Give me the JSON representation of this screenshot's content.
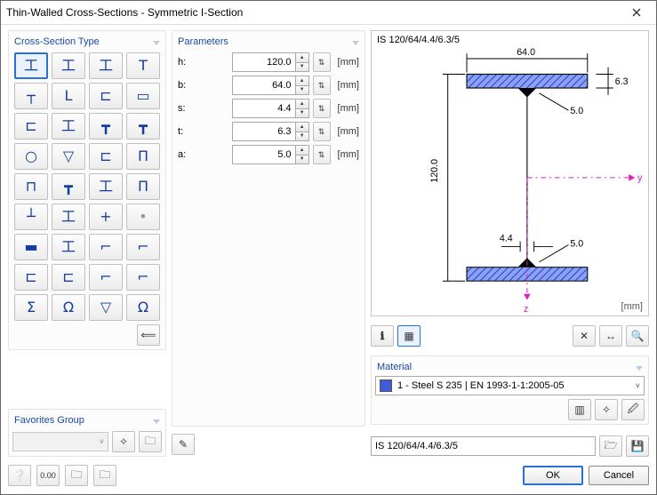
{
  "window": {
    "title": "Thin-Walled Cross-Sections - Symmetric I-Section"
  },
  "crossSection": {
    "title": "Cross-Section Type",
    "items": [
      {
        "name": "i-section",
        "g": "工"
      },
      {
        "name": "i-asym",
        "g": "工"
      },
      {
        "name": "i-left",
        "g": "工"
      },
      {
        "name": "t-section",
        "g": "T"
      },
      {
        "name": "t-down",
        "g": "┬"
      },
      {
        "name": "angle-l",
        "g": "L"
      },
      {
        "name": "channel-c",
        "g": "⊏"
      },
      {
        "name": "rect-tube",
        "g": "▭"
      },
      {
        "name": "channel-open",
        "g": "⊏"
      },
      {
        "name": "i2",
        "g": "工"
      },
      {
        "name": "t-y",
        "g": "┳"
      },
      {
        "name": "y-section",
        "g": "┳"
      },
      {
        "name": "circle",
        "g": "○"
      },
      {
        "name": "triangle",
        "g": "▽"
      },
      {
        "name": "channel2",
        "g": "⊏"
      },
      {
        "name": "pi",
        "g": "Π"
      },
      {
        "name": "double-channel",
        "g": "⊓"
      },
      {
        "name": "i-top",
        "g": "┳"
      },
      {
        "name": "i3",
        "g": "工"
      },
      {
        "name": "pi2",
        "g": "Π"
      },
      {
        "name": "tee-down",
        "g": "┴"
      },
      {
        "name": "i4",
        "g": "工"
      },
      {
        "name": "plus",
        "g": "+"
      },
      {
        "name": "dot",
        "g": "•"
      },
      {
        "name": "flat-bar",
        "g": "▬"
      },
      {
        "name": "i5",
        "g": "工"
      },
      {
        "name": "zee",
        "g": "⌐"
      },
      {
        "name": "zee2",
        "g": "⌐"
      },
      {
        "name": "channel3",
        "g": "⊏"
      },
      {
        "name": "channel4",
        "g": "⊏"
      },
      {
        "name": "angle2",
        "g": "⌐"
      },
      {
        "name": "angle3",
        "g": "⌐"
      },
      {
        "name": "sigma",
        "g": "Σ"
      },
      {
        "name": "omega",
        "g": "Ω"
      },
      {
        "name": "trap",
        "g": "▽"
      },
      {
        "name": "omega2",
        "g": "Ω"
      }
    ]
  },
  "favorites": {
    "title": "Favorites Group"
  },
  "parameters": {
    "title": "Parameters",
    "rows": [
      {
        "k": "h",
        "label": "h:",
        "value": "120.0",
        "unit": "[mm]"
      },
      {
        "k": "b",
        "label": "b:",
        "value": "64.0",
        "unit": "[mm]"
      },
      {
        "k": "s",
        "label": "s:",
        "value": "4.4",
        "unit": "[mm]"
      },
      {
        "k": "t",
        "label": "t:",
        "value": "6.3",
        "unit": "[mm]"
      },
      {
        "k": "a",
        "label": "a:",
        "value": "5.0",
        "unit": "[mm]"
      }
    ]
  },
  "preview": {
    "designation": "IS 120/64/4.4/6.3/5",
    "unit": "[mm]",
    "dims": {
      "b": "64.0",
      "h": "120.0",
      "s": "4.4",
      "t": "6.3",
      "a": "5.0",
      "y": "y",
      "z": "z"
    }
  },
  "material": {
    "title": "Material",
    "selected": "1 - Steel S 235 | EN 1993-1-1:2005-05"
  },
  "description": {
    "value": "IS 120/64/4.4/6.3/5"
  },
  "buttons": {
    "ok": "OK",
    "cancel": "Cancel"
  }
}
